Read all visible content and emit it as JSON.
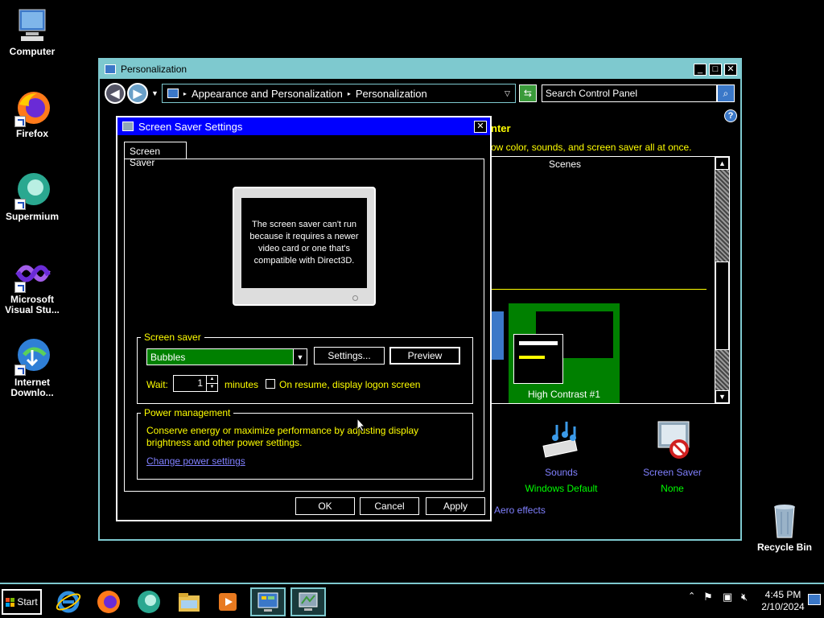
{
  "desktop": {
    "icons": [
      {
        "label": "Computer"
      },
      {
        "label": "Firefox"
      },
      {
        "label": "Supermium"
      },
      {
        "label": "Microsoft Visual Stu..."
      },
      {
        "label": "Internet Downlo..."
      },
      {
        "label": "Recycle Bin"
      }
    ]
  },
  "main_window": {
    "title": "Personalization",
    "breadcrumb": [
      "Appearance and Personalization",
      "Personalization"
    ],
    "search_placeholder": "Search Control Panel",
    "heading_partial": "nter",
    "subtext_partial": "ow color, sounds, and screen saver all at once.",
    "scenes_label": "Scenes",
    "theme_name": "High Contrast #1",
    "sounds_title": "Sounds",
    "sounds_value": "Windows Default",
    "screensaver_title": "Screen Saver",
    "screensaver_value": "None",
    "aero_link": "Aero effects"
  },
  "dialog": {
    "title": "Screen Saver Settings",
    "tab": "Screen Saver",
    "preview_message": "The screen saver can't run because it requires a newer video card or one that's compatible with Direct3D.",
    "screensaver_group": "Screen saver",
    "selected_screensaver": "Bubbles",
    "settings_button": "Settings...",
    "preview_button": "Preview",
    "wait_label": "Wait:",
    "wait_value": "1",
    "minutes_label": "minutes",
    "resume_label": "On resume, display logon screen",
    "power_group": "Power management",
    "power_text": "Conserve energy or maximize performance by adjusting display brightness and other power settings.",
    "power_link": "Change power settings",
    "ok": "OK",
    "cancel": "Cancel",
    "apply": "Apply"
  },
  "taskbar": {
    "start": "Start",
    "time": "4:45 PM",
    "date": "2/10/2024"
  },
  "colors": {
    "accent": "#7ec9cf",
    "highlight_yellow": "#ffff00",
    "title_blue": "#0000ff",
    "selection_green": "#008000"
  }
}
